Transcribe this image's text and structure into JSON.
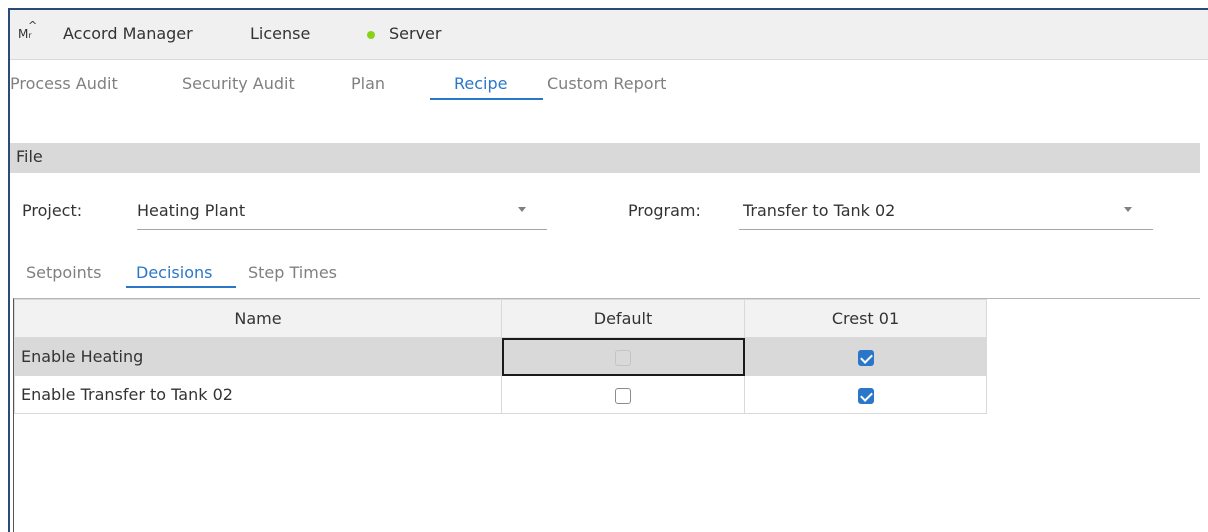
{
  "topbar": {
    "logo": "M",
    "logo_sub": "Mr",
    "items": [
      "Accord Manager",
      "License",
      "Server"
    ],
    "server_status_color": "#88d317"
  },
  "tabs": [
    "Process Audit",
    "Security Audit",
    "Plan",
    "Recipe",
    "Custom Report"
  ],
  "active_tab": "Recipe",
  "section": {
    "title": "File"
  },
  "form": {
    "project_label": "Project:",
    "project_value": "Heating Plant",
    "program_label": "Program:",
    "program_value": "Transfer to Tank 02"
  },
  "subtabs": [
    "Setpoints",
    "Decisions",
    "Step Times"
  ],
  "active_subtab": "Decisions",
  "grid": {
    "columns": [
      "Name",
      "Default",
      "Crest 01"
    ],
    "rows": [
      {
        "name": "Enable Heating",
        "default": false,
        "default_disabled": true,
        "crest01": true
      },
      {
        "name": "Enable Transfer to Tank 02",
        "default": false,
        "default_disabled": false,
        "crest01": true
      }
    ]
  },
  "colors": {
    "accent": "#2a77c9",
    "selected_row": "#d9d9d9",
    "header_bg": "#f0f0f0"
  }
}
